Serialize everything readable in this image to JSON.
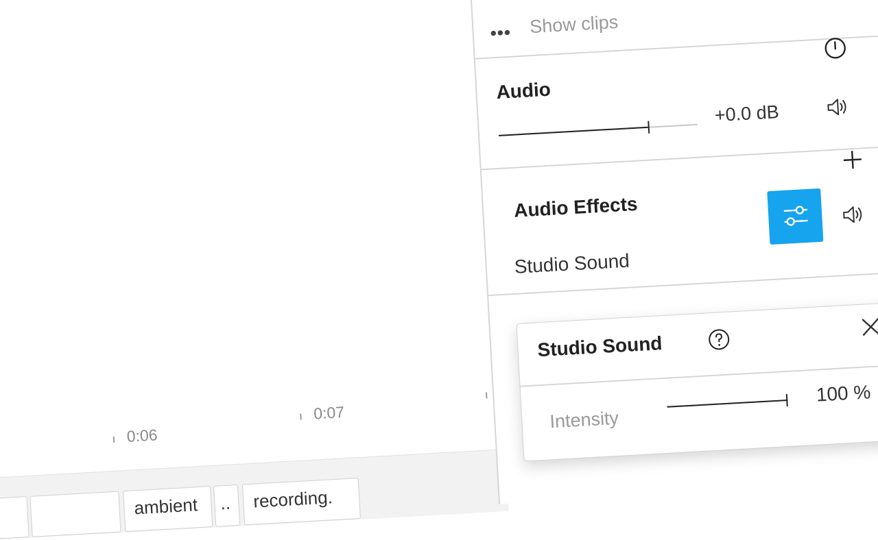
{
  "timeline": {
    "ruler": [
      {
        "label": "0:06"
      },
      {
        "label": "0:07"
      }
    ],
    "clips": [
      "",
      "",
      "ambient",
      "..",
      "recording."
    ]
  },
  "panel": {
    "more_icon": "more-horizontal-icon",
    "show_clips": "Show clips",
    "audio": {
      "title": "Audio",
      "volume_value": "+0.0 dB",
      "volume_level": 0.75,
      "power_icon": "power-icon",
      "speaker_icon": "speaker-icon"
    },
    "audio_effects": {
      "title": "Audio Effects",
      "add_icon": "plus-icon",
      "items": [
        {
          "name": "Studio Sound",
          "settings_icon": "sliders-icon",
          "speaker_icon": "speaker-icon"
        }
      ]
    }
  },
  "popover": {
    "title": "Studio Sound",
    "help_icon": "help-circle-icon",
    "close_icon": "close-icon",
    "intensity_label": "Intensity",
    "intensity_value": "100 %",
    "intensity_level": 1.0
  },
  "colors": {
    "accent": "#16a4ee",
    "text": "#222222",
    "muted": "#9a9a9a",
    "divider": "#d6d6d6"
  }
}
